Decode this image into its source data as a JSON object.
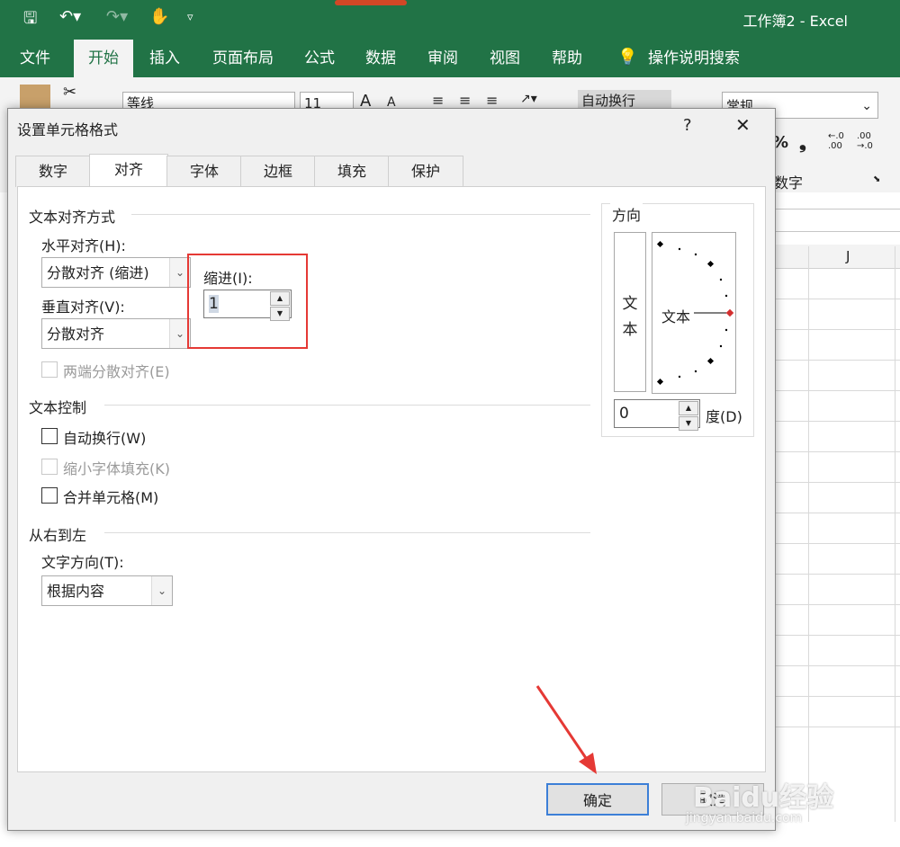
{
  "window": {
    "title": "工作簿2 - Excel"
  },
  "quick_access": {
    "save_icon": "save-icon",
    "undo_icon": "undo-icon",
    "redo_icon": "redo-icon",
    "touch_icon": "touch-mode-icon",
    "customize_icon": "customize-icon"
  },
  "ribbon_tabs": [
    {
      "label": "文件"
    },
    {
      "label": "开始"
    },
    {
      "label": "插入"
    },
    {
      "label": "页面布局"
    },
    {
      "label": "公式"
    },
    {
      "label": "数据"
    },
    {
      "label": "审阅"
    },
    {
      "label": "视图"
    },
    {
      "label": "帮助"
    },
    {
      "label": "操作说明搜索"
    }
  ],
  "ribbon": {
    "font_name": "等线",
    "font_size": "11",
    "wrap_text": "自动换行",
    "number_format": "常规",
    "number_group": "数字",
    "percent": "%",
    "comma": "❟",
    "inc_decimal": "←.0\n.00",
    "dec_decimal": ".00\n→.0"
  },
  "sheet": {
    "column_j": "J"
  },
  "dialog": {
    "title": "设置单元格格式",
    "help": "?",
    "close": "✕",
    "tabs": [
      {
        "label": "数字"
      },
      {
        "label": "对齐"
      },
      {
        "label": "字体"
      },
      {
        "label": "边框"
      },
      {
        "label": "填充"
      },
      {
        "label": "保护"
      }
    ],
    "text_alignment": {
      "section": "文本对齐方式",
      "horizontal_label": "水平对齐(H):",
      "horizontal_value": "分散对齐 (缩进)",
      "vertical_label": "垂直对齐(V):",
      "vertical_value": "分散对齐",
      "justify_distributed": "两端分散对齐(E)",
      "indent_label": "缩进(I):",
      "indent_value": "1"
    },
    "text_control": {
      "section": "文本控制",
      "wrap": "自动换行(W)",
      "shrink": "缩小字体填充(K)",
      "merge": "合并单元格(M)"
    },
    "rtl": {
      "section": "从右到左",
      "direction_label": "文字方向(T):",
      "direction_value": "根据内容"
    },
    "orientation": {
      "section": "方向",
      "vertical_text_1": "文",
      "vertical_text_2": "本",
      "dial_text": "文本",
      "degree_value": "0",
      "degree_label": "度(D)"
    },
    "ok": "确定",
    "cancel": "取消"
  },
  "watermark": {
    "text": "Baidu经验",
    "sub": "jingyan.baidu.com"
  },
  "colors": {
    "excel_green": "#217346",
    "highlight_red": "#e53935"
  }
}
